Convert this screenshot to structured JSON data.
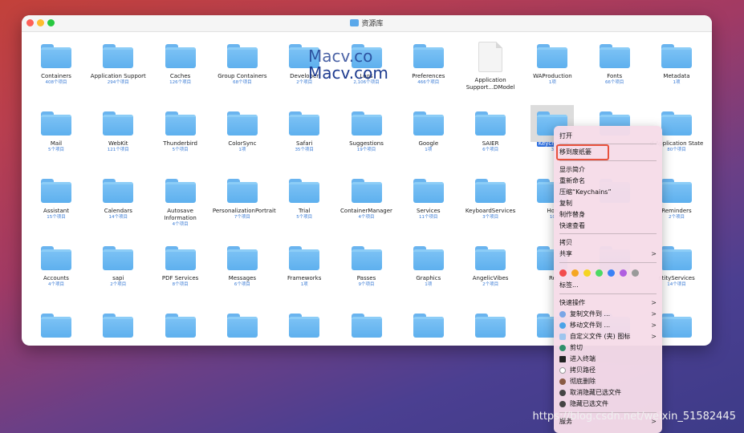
{
  "window": {
    "title": "资源库"
  },
  "watermark": {
    "line1": "Macv.co",
    "line2": "Macv.com"
  },
  "items": [
    {
      "name": "Containers",
      "count": "408个项目"
    },
    {
      "name": "Application Support",
      "count": "294个项目"
    },
    {
      "name": "Caches",
      "count": "126个项目"
    },
    {
      "name": "Group Containers",
      "count": "68个项目"
    },
    {
      "name": "Developer",
      "count": "2个项目"
    },
    {
      "name": "Logs",
      "count": "2,106个项目"
    },
    {
      "name": "Preferences",
      "count": "466个项目"
    },
    {
      "name": "Application Support...DModel",
      "count": ""
    },
    {
      "name": "WAProduction",
      "count": "1项"
    },
    {
      "name": "Fonts",
      "count": "66个项目"
    },
    {
      "name": "Metadata",
      "count": "1项"
    },
    {
      "name": "Mail",
      "count": "5个项目"
    },
    {
      "name": "WebKit",
      "count": "121个项目"
    },
    {
      "name": "Thunderbird",
      "count": "5个项目"
    },
    {
      "name": "ColorSync",
      "count": "1项"
    },
    {
      "name": "Safari",
      "count": "35个项目"
    },
    {
      "name": "Suggestions",
      "count": "19个项目"
    },
    {
      "name": "Google",
      "count": "1项"
    },
    {
      "name": "SAIER",
      "count": "6个项目"
    },
    {
      "name": "Keychains",
      "count": "3"
    },
    {
      "name": "",
      "count": ""
    },
    {
      "name": "d Application State",
      "count": "80个项目"
    },
    {
      "name": "Assistant",
      "count": "15个项目"
    },
    {
      "name": "Calendars",
      "count": "14个项目"
    },
    {
      "name": "Autosave Information",
      "count": "4个项目"
    },
    {
      "name": "PersonalizationPortrait",
      "count": "7个项目"
    },
    {
      "name": "Trial",
      "count": "5个项目"
    },
    {
      "name": "ContainerManager",
      "count": "4个项目"
    },
    {
      "name": "Services",
      "count": "11个项目"
    },
    {
      "name": "KeyboardServices",
      "count": "3个项目"
    },
    {
      "name": "Hon",
      "count": "10"
    },
    {
      "name": "",
      "count": ""
    },
    {
      "name": "Reminders",
      "count": "2个项目"
    },
    {
      "name": "Accounts",
      "count": "4个项目"
    },
    {
      "name": "sapi",
      "count": "2个项目"
    },
    {
      "name": "PDF Services",
      "count": "8个项目"
    },
    {
      "name": "Messages",
      "count": "6个项目"
    },
    {
      "name": "Frameworks",
      "count": "1项"
    },
    {
      "name": "Passes",
      "count": "9个项目"
    },
    {
      "name": "Graphics",
      "count": "1项"
    },
    {
      "name": "AngelicVibes",
      "count": "2个项目"
    },
    {
      "name": "Re",
      "count": ""
    },
    {
      "name": "",
      "count": ""
    },
    {
      "name": "ntityServices",
      "count": "14个项目"
    }
  ],
  "menu": {
    "open": "打开",
    "move_to_trash": "移到废纸篓",
    "get_info": "显示简介",
    "rename": "重新命名",
    "compress": "压缩“Keychains”",
    "duplicate": "复制",
    "make_alias": "制作替身",
    "quick_look": "快速查看",
    "copy": "拷贝",
    "share": "共享",
    "tags": "标签...",
    "quick_actions": "快速操作",
    "copy_file_to": "复制文件到 ...",
    "move_file_to": "移动文件到 ...",
    "custom_icon": "自定义文件 (夹) 图标",
    "cut": "剪切",
    "open_terminal": "进入终端",
    "copy_path": "拷贝路径",
    "delete_permanently": "彻底删除",
    "unhide_selected": "取消隐藏已选文件",
    "hide_selected": "隐藏已选文件",
    "services": "服务",
    "tag_colors": [
      "#f24c4c",
      "#f5a623",
      "#f5d423",
      "#4cd964",
      "#3b82f6",
      "#b05ee0",
      "#9a9a9a"
    ]
  },
  "csdn": "https://blog.csdn.net/weixin_51582445"
}
